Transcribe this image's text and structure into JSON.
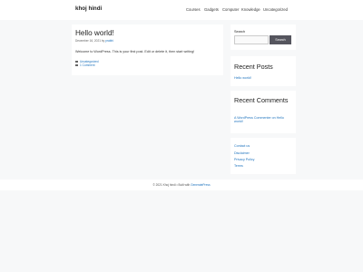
{
  "site": {
    "title": "khoj hindi"
  },
  "nav": {
    "items": [
      {
        "label": "Courses"
      },
      {
        "label": "Gadgets"
      },
      {
        "label": "Computer"
      },
      {
        "label": "Knowledge"
      },
      {
        "label": "Uncategorized"
      }
    ]
  },
  "post": {
    "title": "Hello world!",
    "date": "December 16, 2021",
    "by": "by",
    "author": "prabhi",
    "excerpt": "Welcome to WordPress. This is your first post. Edit or delete it, then start writing!",
    "category": "Uncategorized",
    "comment": "1 Comment"
  },
  "search": {
    "label": "Search",
    "input_value": "",
    "button_label": "Search"
  },
  "recent_posts": {
    "title": "Recent Posts",
    "items": [
      {
        "label": "Hello world!"
      }
    ]
  },
  "recent_comments": {
    "title": "Recent Comments",
    "text": "A WordPress Commenter on Hello world!"
  },
  "links": {
    "items": [
      {
        "label": "Contact us"
      },
      {
        "label": "Disclaimer"
      },
      {
        "label": "Privacy Policy"
      },
      {
        "label": "Terms"
      }
    ]
  },
  "footer": {
    "prefix": "© 2021 Khoj hindi • Built with",
    "link": "GeneratePress"
  }
}
